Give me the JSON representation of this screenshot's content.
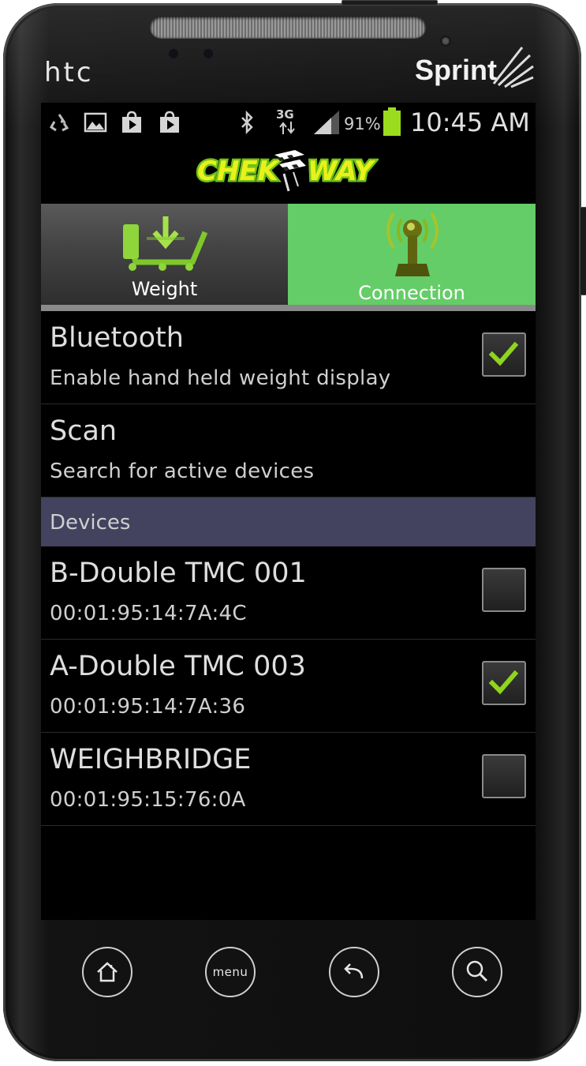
{
  "device": {
    "maker": "htc",
    "carrier": "Sprint"
  },
  "statusbar": {
    "notification_icons": [
      "recycle-icon",
      "image-icon",
      "play-store-icon",
      "play-store-icon"
    ],
    "network": "3G",
    "battery_percent": "91%",
    "time": "10:45 AM",
    "battery_color": "#9bdc1e"
  },
  "app": {
    "logo_text": "CHEK WAY"
  },
  "tabs": [
    {
      "label": "Weight",
      "icon": "cart-download-icon",
      "selected": false
    },
    {
      "label": "Connection",
      "icon": "antenna-icon",
      "selected": true
    }
  ],
  "settings": {
    "bluetooth": {
      "title": "Bluetooth",
      "subtitle": "Enable hand held weight display",
      "checked": true
    },
    "scan": {
      "title": "Scan",
      "subtitle": "Search for active devices"
    }
  },
  "devices": {
    "header": "Devices",
    "items": [
      {
        "name": "B-Double TMC 001",
        "address": "00:01:95:14:7A:4C",
        "checked": false
      },
      {
        "name": "A-Double TMC 003",
        "address": "00:01:95:14:7A:36",
        "checked": true
      },
      {
        "name": "WEIGHBRIDGE",
        "address": "00:01:95:15:76:0A",
        "checked": false
      }
    ]
  },
  "hardware_keys": {
    "home": "home-icon",
    "menu": "menu",
    "back": "back-icon",
    "search": "search-icon"
  },
  "colors": {
    "selected_tab": "#64cd67",
    "section_header": "#43425f",
    "check": "#8fd41e"
  }
}
